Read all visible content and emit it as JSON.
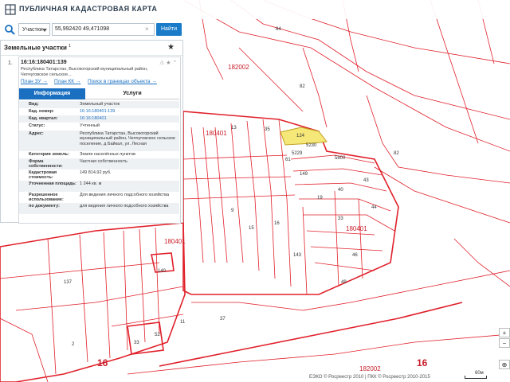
{
  "app": {
    "title": "ПУБЛИЧНАЯ КАДАСТРОВАЯ КАРТА"
  },
  "search": {
    "type_select": "Участки",
    "query": "55,992420 49,471098",
    "find_label": "Найти"
  },
  "panel": {
    "title": "Земельные участки",
    "count": "1",
    "result": {
      "index": "1.",
      "cad_number": "16:16:180401:139",
      "address_short": "Республика Татарстан, Высокогорский муниципальный район, Чепчуговское сельское...",
      "links": [
        "План ЗУ →",
        "План КК →",
        "Поиск в границах объекта →"
      ]
    },
    "tabs": {
      "info": "Информация",
      "services": "Услуги"
    },
    "rows": [
      {
        "label": "Вид:",
        "value": "Земельный участок"
      },
      {
        "label": "Кад. номер:",
        "value": "16:16:180401:139"
      },
      {
        "label": "Кад. квартал:",
        "value": "16:16:180401"
      },
      {
        "label": "Статус:",
        "value": "Учтенный"
      },
      {
        "label": "Адрес:",
        "value": "Республика Татарстан, Высокогорский муниципальный район, Чепчуговское сельское поселение, д Байкал, ул. Лесная"
      },
      {
        "label": "Категория земель:",
        "value": "Земли населённых пунктов"
      },
      {
        "label": "Форма собственности:",
        "value": "Частная собственность"
      },
      {
        "label": "Кадастровая стоимость:",
        "value": "149 814,92 руб."
      },
      {
        "label": "Уточненная площадь:",
        "value": "1 244 кв. м"
      },
      {
        "label": "Разрешенное использование:",
        "value": "Для ведения личного подсобного хозяйства"
      },
      {
        "label": "по документу:",
        "value": "для ведения личного подсобного хозяйства"
      }
    ]
  },
  "map": {
    "labels": {
      "q1": "182002",
      "q2": "180401",
      "q3": "180401",
      "q4": "180401",
      "p84": "84",
      "p82a": "82",
      "p82b": "82",
      "p37": "37",
      "p16a": "16",
      "p16b": "16",
      "q5": "182002",
      "p124": "124",
      "p5230": "5230",
      "p5229": "5229",
      "p5800": "5800",
      "p61": "61",
      "p13": "13",
      "p35": "35",
      "p43": "43",
      "p44": "44",
      "p33": "33",
      "p46": "46",
      "p49": "49",
      "p140": "140",
      "p137": "137",
      "p15": "15",
      "p9": "9",
      "p2": "2",
      "p33b": "33",
      "p52": "52",
      "p11": "11",
      "p149": "149",
      "p40": "40",
      "p19": "19",
      "p143": "143",
      "p16c": "16"
    },
    "highlight_color": "#f5e878"
  },
  "zoom": {
    "in": "+",
    "out": "−",
    "extra": "⊕"
  },
  "footer": {
    "copyright": "ЕЭКО © Росреестр 2010 | ПКК © Росреестр 2010-2015",
    "scale": "60м"
  }
}
